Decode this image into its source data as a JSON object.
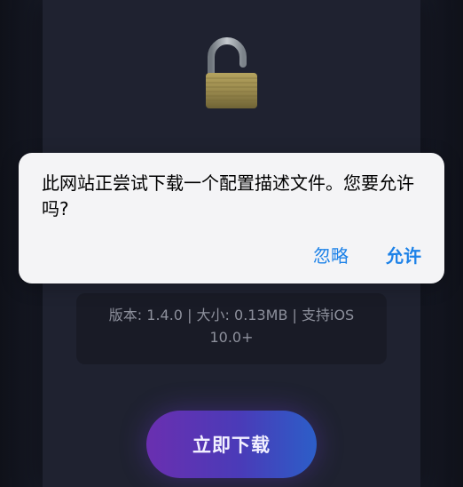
{
  "background": {
    "panel_color": "#1f2230",
    "edge_color": "#12141c"
  },
  "lock_icon": {
    "name": "open-padlock-icon",
    "body_color": "#9a8a4e",
    "shackle_color": "#8e959c"
  },
  "info": {
    "line": "版本: 1.4.0 | 大小: 0.13MB | 支持iOS 10.0+"
  },
  "download_button": {
    "label": "立即下载",
    "gradient": [
      "#6a2fb0",
      "#2c5ec8"
    ]
  },
  "alert": {
    "message": "此网站正尝试下载一个配置描述文件。您要允许吗?",
    "ignore_label": "忽略",
    "allow_label": "允许",
    "action_color": "#1d82e8"
  }
}
